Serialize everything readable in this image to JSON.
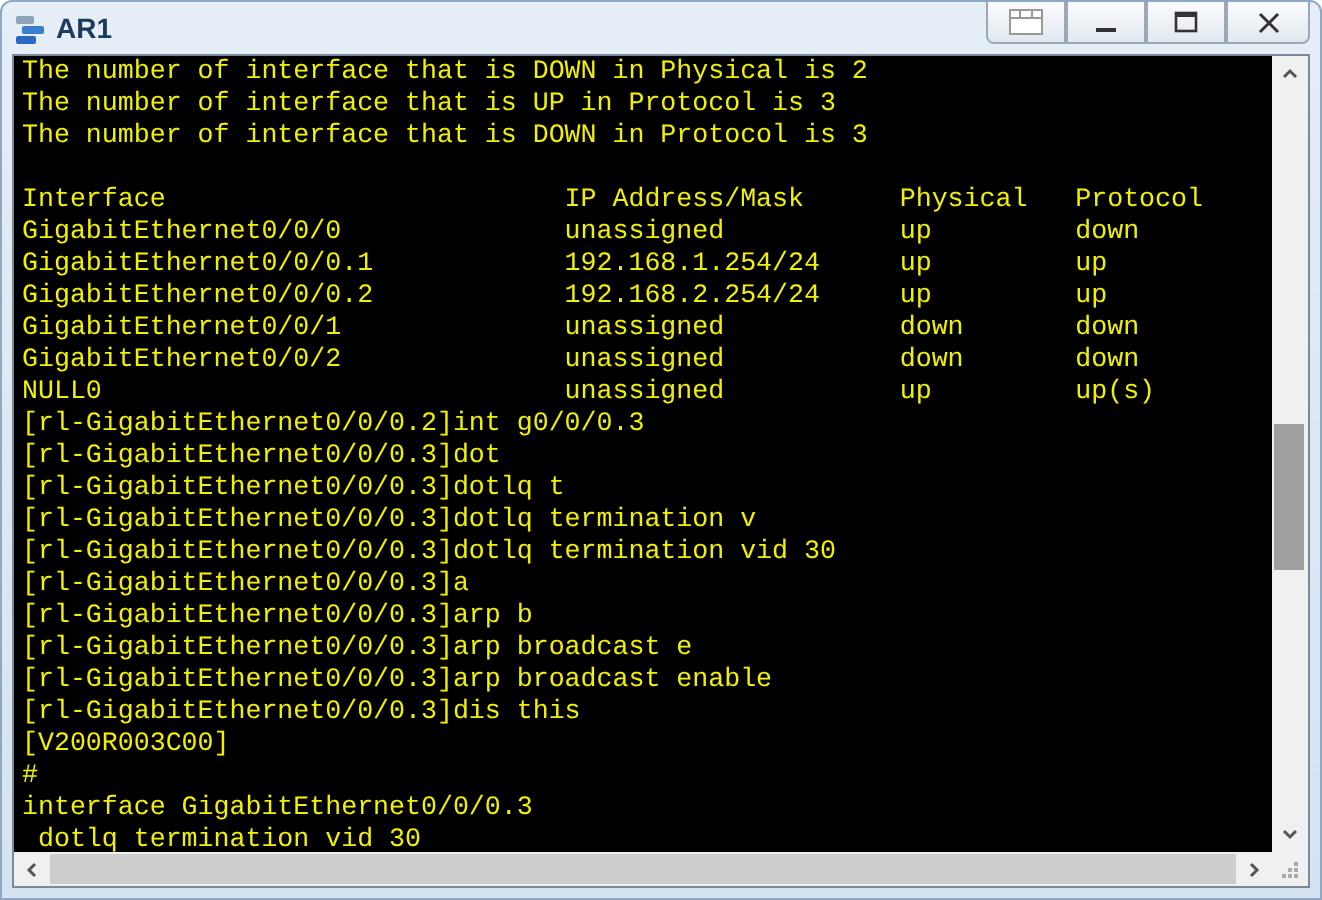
{
  "window": {
    "title": "AR1"
  },
  "summary_lines": [
    "The number of interface that is DOWN in Physical is 2",
    "The number of interface that is UP in Protocol is 3",
    "The number of interface that is DOWN in Protocol is 3"
  ],
  "table": {
    "columns": [
      "Interface",
      "IP Address/Mask",
      "Physical",
      "Protocol"
    ],
    "rows": [
      [
        "GigabitEthernet0/0/0",
        "unassigned",
        "up",
        "down"
      ],
      [
        "GigabitEthernet0/0/0.1",
        "192.168.1.254/24",
        "up",
        "up"
      ],
      [
        "GigabitEthernet0/0/0.2",
        "192.168.2.254/24",
        "up",
        "up"
      ],
      [
        "GigabitEthernet0/0/1",
        "unassigned",
        "down",
        "down"
      ],
      [
        "GigabitEthernet0/0/2",
        "unassigned",
        "down",
        "down"
      ],
      [
        "NULL0",
        "unassigned",
        "up",
        "up(s)"
      ]
    ]
  },
  "console_lines": [
    "[rl-GigabitEthernet0/0/0.2]int g0/0/0.3",
    "[rl-GigabitEthernet0/0/0.3]dot",
    "[rl-GigabitEthernet0/0/0.3]dotlq t",
    "[rl-GigabitEthernet0/0/0.3]dotlq termination v",
    "[rl-GigabitEthernet0/0/0.3]dotlq termination vid 30",
    "[rl-GigabitEthernet0/0/0.3]a",
    "[rl-GigabitEthernet0/0/0.3]arp b",
    "[rl-GigabitEthernet0/0/0.3]arp broadcast e",
    "[rl-GigabitEthernet0/0/0.3]arp broadcast enable",
    "[rl-GigabitEthernet0/0/0.3]dis this",
    "[V200R003C00]",
    "#",
    "interface GigabitEthernet0/0/0.3",
    " dotlq termination vid 30"
  ]
}
